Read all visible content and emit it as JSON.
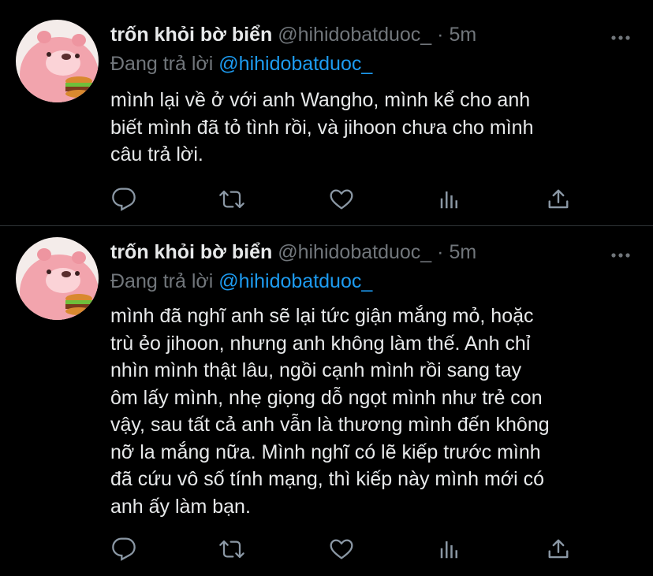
{
  "tweets": [
    {
      "display_name": "trốn khỏi bờ biển",
      "handle": "@hihidobatduoc_",
      "separator": "·",
      "time": "5m",
      "replying_prefix": "Đang trả lời",
      "replying_to": "@hihidobatduoc_",
      "lines": [
        "mình lại về ở với anh Wangho, mình kể cho anh",
        "biết mình đã tỏ tình rồi, và jihoon chưa cho mình",
        "câu trả lời."
      ]
    },
    {
      "display_name": "trốn khỏi bờ biển",
      "handle": "@hihidobatduoc_",
      "separator": "·",
      "time": "5m",
      "replying_prefix": "Đang trả lời",
      "replying_to": "@hihidobatduoc_",
      "lines": [
        "mình đã nghĩ anh sẽ lại tức giận mắng mỏ, hoặc",
        "trù ẻo jihoon, nhưng anh không làm thế. Anh chỉ",
        "nhìn mình thật lâu, ngồi cạnh mình rồi sang tay",
        "ôm lấy mình, nhẹ giọng dỗ ngọt mình như trẻ con",
        "vậy, sau tất cả anh vẫn là thương mình đến không",
        "nỡ la mắng nữa. Mình nghĩ có lẽ kiếp trước mình",
        "đã cứu vô số tính mạng, thì kiếp này mình mới có",
        "anh ấy làm bạn."
      ]
    }
  ],
  "icons": {
    "avatar": "pink-beaver-eating-burger-avatar",
    "more": "more-horizontal-icon",
    "reply": "reply-icon",
    "retweet": "retweet-icon",
    "like": "heart-icon",
    "stats": "analytics-icon",
    "share": "share-icon"
  },
  "colors": {
    "background": "#000000",
    "text": "#e7e9ea",
    "muted": "#71767b",
    "link": "#1d9bf0",
    "divider": "#2f3336"
  }
}
